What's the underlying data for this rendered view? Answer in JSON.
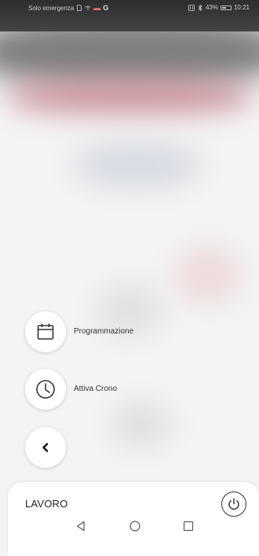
{
  "status_bar": {
    "carrier": "Solo emergenza",
    "battery": "43%",
    "time": "10:21",
    "icons": [
      "sim-icon",
      "wifi-icon",
      "cake-icon",
      "google-icon",
      "nfc-icon",
      "bluetooth-icon",
      "battery-icon"
    ]
  },
  "menu": {
    "items": [
      {
        "label": "Programmazione",
        "icon": "calendar-icon"
      },
      {
        "label": "Attiva Crono",
        "icon": "clock-icon"
      }
    ],
    "back_icon": "chevron-left-icon"
  },
  "sheet": {
    "title": "LAVORO",
    "power_icon": "power-icon"
  },
  "nav": {
    "buttons": [
      "back-icon",
      "home-icon",
      "recents-icon"
    ]
  },
  "colors": {
    "accent_blur": "#c98a93",
    "sheet_bg": "#ffffff",
    "icon": "#333333"
  }
}
